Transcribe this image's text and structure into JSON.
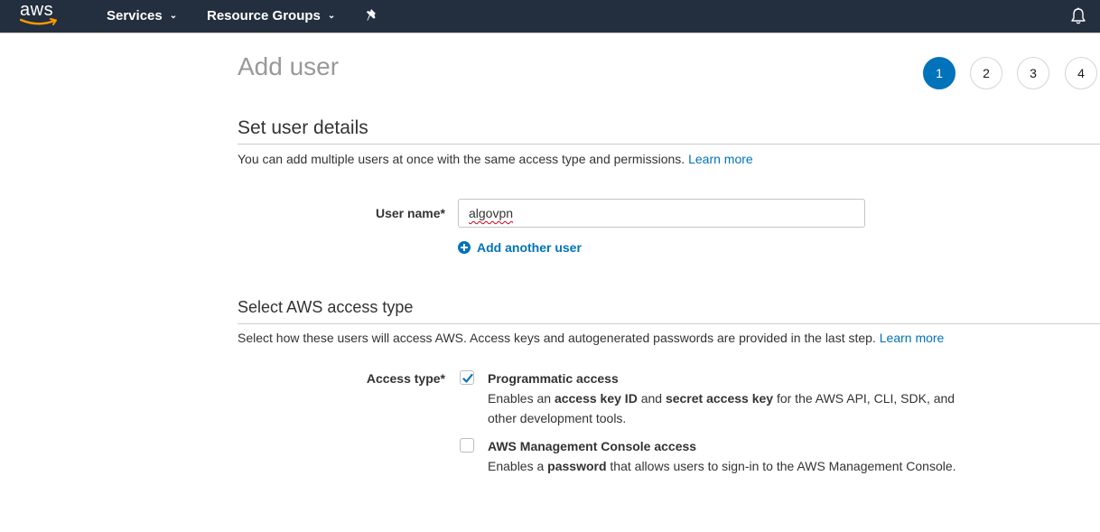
{
  "topnav": {
    "logo_text": "aws",
    "services_label": "Services",
    "resource_groups_label": "Resource Groups",
    "pin_icon": "pushpin-icon",
    "bell_icon": "bell-icon"
  },
  "page": {
    "title": "Add user"
  },
  "steps": [
    {
      "label": "1",
      "active": true
    },
    {
      "label": "2",
      "active": false
    },
    {
      "label": "3",
      "active": false
    },
    {
      "label": "4",
      "active": false
    }
  ],
  "user_details": {
    "title": "Set user details",
    "description": "You can add multiple users at once with the same access type and permissions.",
    "learn_more": "Learn more",
    "username_label": "User name*",
    "username_value": "algovpn",
    "add_another_label": "Add another user"
  },
  "access_type": {
    "title": "Select AWS access type",
    "description": "Select how these users will access AWS. Access keys and autogenerated passwords are provided in the last step.",
    "learn_more": "Learn more",
    "label": "Access type*",
    "options": [
      {
        "title": "Programmatic access",
        "checked": true,
        "desc_parts": [
          "Enables an ",
          "access key ID",
          " and ",
          "secret access key",
          " for the AWS API, CLI, SDK, and other development tools."
        ]
      },
      {
        "title": "AWS Management Console access",
        "checked": false,
        "desc_parts": [
          "Enables a ",
          "password",
          " that allows users to sign-in to the AWS Management Console."
        ]
      }
    ]
  },
  "colors": {
    "nav_bg": "#232f3e",
    "accent": "#0073bb",
    "logo_smile": "#ff9900"
  }
}
